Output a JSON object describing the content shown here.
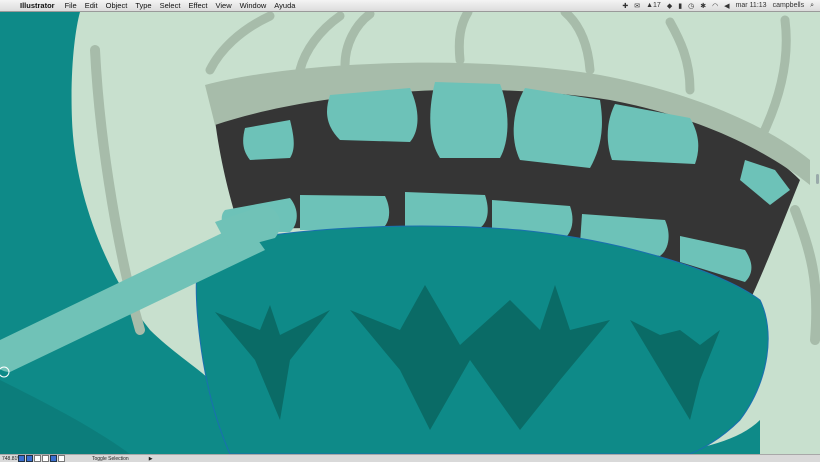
{
  "menubar": {
    "apple_symbol": "",
    "app_name": "Illustrator",
    "menus": [
      "File",
      "Edit",
      "Object",
      "Type",
      "Select",
      "Effect",
      "View",
      "Window",
      "Ayuda"
    ],
    "tray_badge": "17",
    "clock": "mar 11:13",
    "user": "campbells",
    "icons": [
      "dropbox-icon",
      "mail-icon",
      "adobe-icon",
      "evernote-icon",
      "battery-icon",
      "time-machine-icon",
      "bluetooth-icon",
      "wifi-icon",
      "volume-icon",
      "spotlight-icon"
    ]
  },
  "statusbar": {
    "zoom": "748.81%",
    "toggle_label": "Toggle Selection",
    "arrow": "▶"
  },
  "artwork": {
    "colors": {
      "background": "#0e8a88",
      "lips": "#c8e0ce",
      "lip_lines": "#a7bcaa",
      "mouth": "#353535",
      "teeth": "#6dc2b8",
      "tongue": "#0e8a88",
      "tongue_shadow": "#0a6b66",
      "toothbrush": "#70c2b7"
    }
  }
}
